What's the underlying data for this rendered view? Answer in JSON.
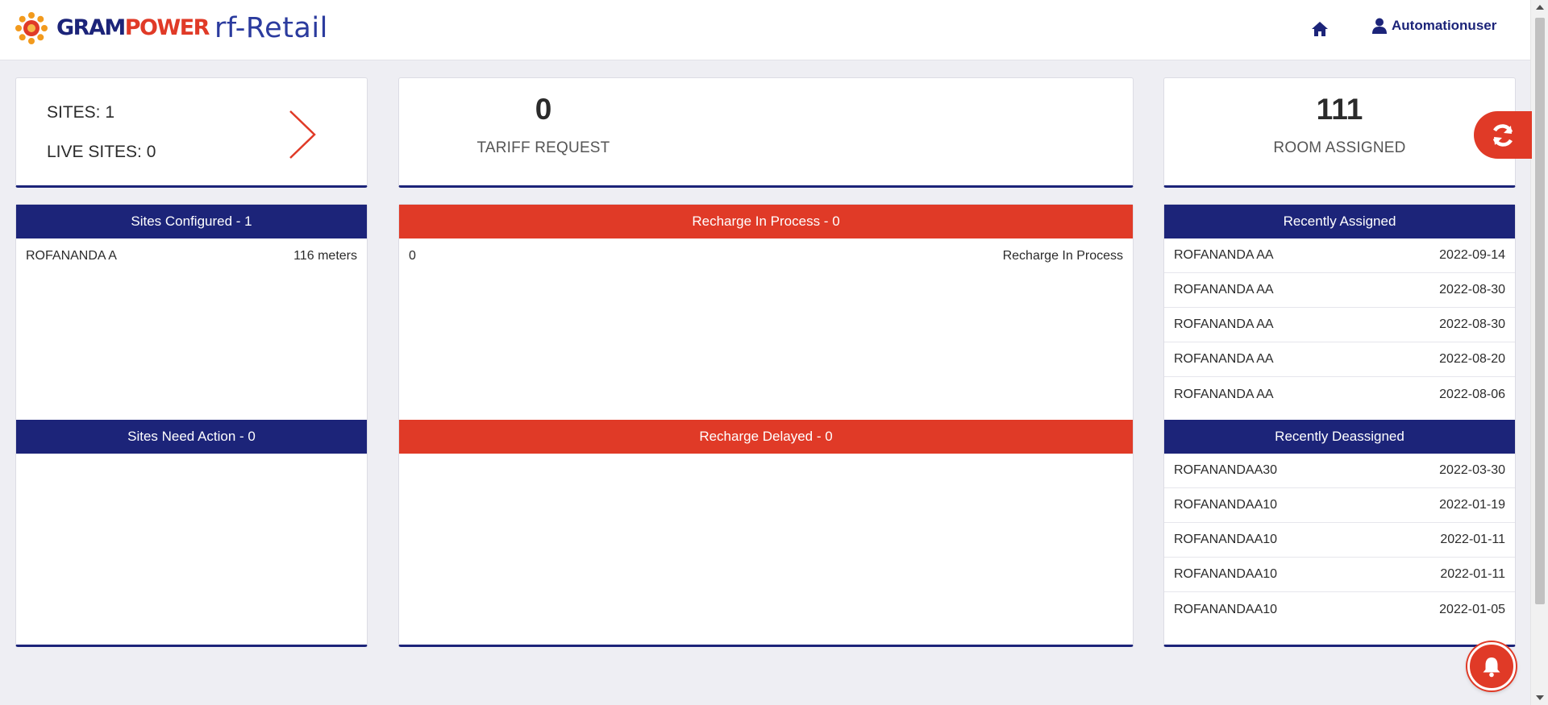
{
  "header": {
    "brand_left": "GRAM",
    "brand_right": "POWER",
    "product": "rf-Retail",
    "user_name": "Automationuser"
  },
  "summary": {
    "sites": "SITES: 1",
    "live_sites": "LIVE SITES: 0",
    "tariff_count": "0",
    "tariff_label": "TARIFF REQUEST",
    "room_count": "111",
    "room_label": "ROOM ASSIGNED"
  },
  "sites_configured": {
    "title": "Sites Configured - 1",
    "rows": [
      {
        "name": "ROFANANDA A",
        "value": "116 meters"
      }
    ]
  },
  "sites_need_action": {
    "title": "Sites Need Action - 0"
  },
  "recharge_in_process": {
    "title": "Recharge In Process - 0",
    "rows": [
      {
        "name": "0",
        "value": "Recharge In Process"
      }
    ]
  },
  "recharge_delayed": {
    "title": "Recharge Delayed - 0"
  },
  "recently_assigned": {
    "title": "Recently Assigned",
    "rows": [
      {
        "name": "ROFANANDA AA",
        "date": "2022-09-14"
      },
      {
        "name": "ROFANANDA AA",
        "date": "2022-08-30"
      },
      {
        "name": "ROFANANDA AA",
        "date": "2022-08-30"
      },
      {
        "name": "ROFANANDA AA",
        "date": "2022-08-20"
      },
      {
        "name": "ROFANANDA AA",
        "date": "2022-08-06"
      }
    ]
  },
  "recently_deassigned": {
    "title": "Recently Deassigned",
    "rows": [
      {
        "name": "ROFANANDAA30",
        "date": "2022-03-30"
      },
      {
        "name": "ROFANANDAA10",
        "date": "2022-01-19"
      },
      {
        "name": "ROFANANDAA10",
        "date": "2022-01-11"
      },
      {
        "name": "ROFANANDAA10",
        "date": "2022-01-11"
      },
      {
        "name": "ROFANANDAA10",
        "date": "2022-01-05"
      }
    ]
  },
  "icons": {
    "logo": "sun-logo-icon",
    "home": "home-icon",
    "user": "user-icon",
    "next": "chevron-right-icon",
    "refresh": "refresh-icon",
    "notifications": "bell-icon"
  },
  "colors": {
    "navy": "#1c2479",
    "red": "#e03a27",
    "background": "#eeeef3"
  }
}
